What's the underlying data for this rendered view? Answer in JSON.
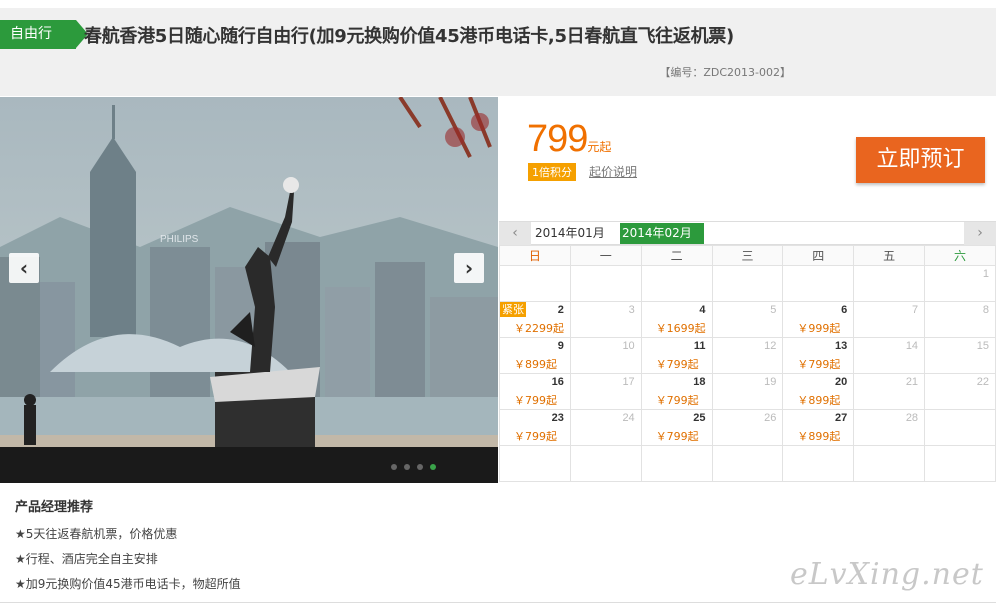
{
  "header": {
    "tag": "自由行",
    "title": "春航香港5日随心随行自由行(加9元换购价值45港币电话卡,5日春航直飞往返机票)",
    "code": "【编号：ZDC2013-002】"
  },
  "gallery": {
    "prev_icon": "chevron-left-icon",
    "next_icon": "chevron-right-icon",
    "prev_glyph": "‹",
    "next_glyph": "›",
    "slide_count": 4,
    "active_slide": 4,
    "sign_text": "PHILIPS"
  },
  "pricing": {
    "price": "799",
    "unit": "元起",
    "points_badge": "1倍积分",
    "points_link": "起价说明",
    "book_label": "立即预订"
  },
  "calendar": {
    "prev_glyph": "‹",
    "next_glyph": "›",
    "months": [
      "2014年01月",
      "2014年02月"
    ],
    "active_month": "2014年02月",
    "weekdays": [
      "日",
      "一",
      "二",
      "三",
      "四",
      "五",
      "六"
    ],
    "tight_label": "紧张",
    "weeks": [
      [
        {
          "d": ""
        },
        {
          "d": ""
        },
        {
          "d": ""
        },
        {
          "d": ""
        },
        {
          "d": ""
        },
        {
          "d": ""
        },
        {
          "d": "1",
          "dim": true
        }
      ],
      [
        {
          "d": "2",
          "p": "￥2299起",
          "tight": true
        },
        {
          "d": "3",
          "dim": true
        },
        {
          "d": "4",
          "p": "￥1699起"
        },
        {
          "d": "5",
          "dim": true
        },
        {
          "d": "6",
          "p": "￥999起"
        },
        {
          "d": "7",
          "dim": true
        },
        {
          "d": "8",
          "dim": true
        }
      ],
      [
        {
          "d": "9",
          "p": "￥899起"
        },
        {
          "d": "10",
          "dim": true
        },
        {
          "d": "11",
          "p": "￥799起"
        },
        {
          "d": "12",
          "dim": true
        },
        {
          "d": "13",
          "p": "￥799起"
        },
        {
          "d": "14",
          "dim": true
        },
        {
          "d": "15",
          "dim": true
        }
      ],
      [
        {
          "d": "16",
          "p": "￥799起"
        },
        {
          "d": "17",
          "dim": true
        },
        {
          "d": "18",
          "p": "￥799起"
        },
        {
          "d": "19",
          "dim": true
        },
        {
          "d": "20",
          "p": "￥899起"
        },
        {
          "d": "21",
          "dim": true
        },
        {
          "d": "22",
          "dim": true
        }
      ],
      [
        {
          "d": "23",
          "p": "￥799起"
        },
        {
          "d": "24",
          "dim": true
        },
        {
          "d": "25",
          "p": "￥799起"
        },
        {
          "d": "26",
          "dim": true
        },
        {
          "d": "27",
          "p": "￥899起"
        },
        {
          "d": "28",
          "dim": true
        },
        {
          "d": ""
        }
      ],
      [
        {
          "d": ""
        },
        {
          "d": ""
        },
        {
          "d": ""
        },
        {
          "d": ""
        },
        {
          "d": ""
        },
        {
          "d": ""
        },
        {
          "d": ""
        }
      ]
    ]
  },
  "recommend": {
    "title": "产品经理推荐",
    "items": [
      "★5天往返春航机票，价格优惠",
      "★行程、酒店完全自主安排",
      "★加9元换购价值45港币电话卡，物超所值"
    ]
  },
  "watermark": "eLvXing.net",
  "colors": {
    "brand_green": "#2c9a3c",
    "price_orange": "#f07000",
    "button_orange": "#e9651f",
    "badge_orange": "#f5a000"
  }
}
